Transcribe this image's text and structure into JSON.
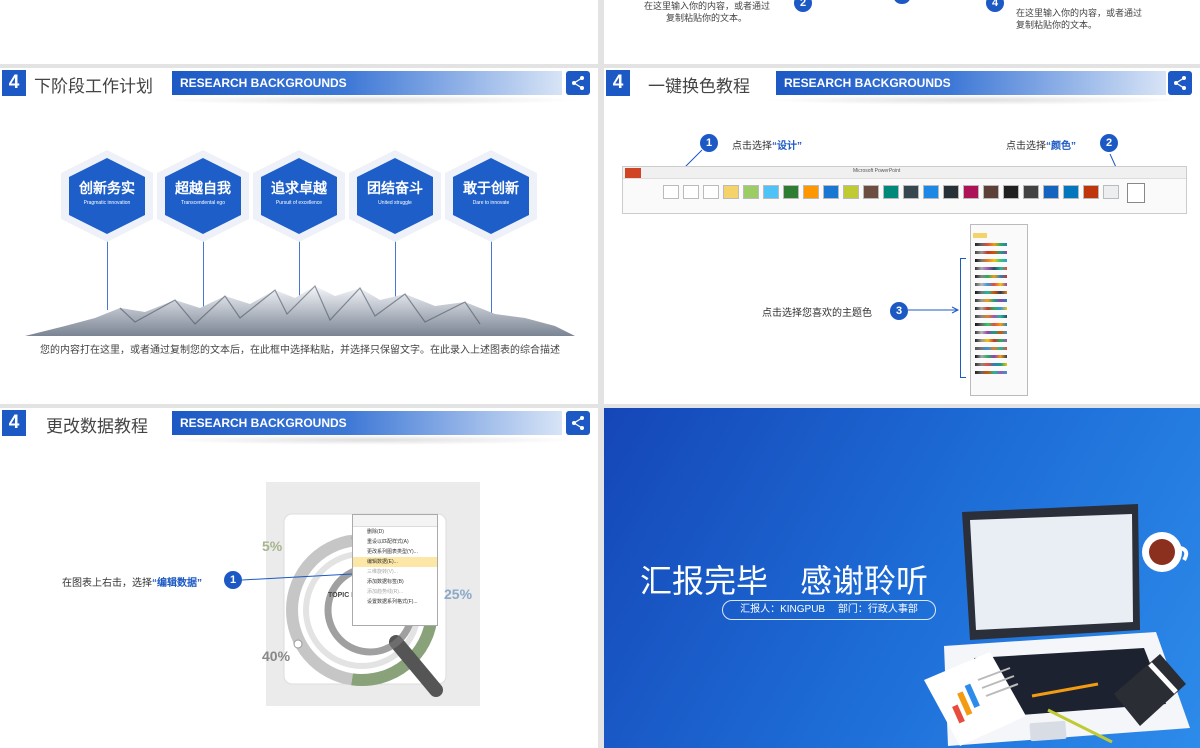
{
  "top_left": {
    "text_1": "在这里输入你的内容，或者通过",
    "text_2": "复制粘贴你的文本。",
    "step": "2"
  },
  "top_right": {
    "text_1": "在这里输入你的内容，或者通过",
    "text_2": "复制粘贴你的文本。",
    "step": "4"
  },
  "plan_slide": {
    "number": "4",
    "title": "下阶段工作计划",
    "banner": "RESEARCH BACKGROUNDS",
    "hexagons": [
      {
        "cn": "创新务实",
        "en": "Pragmatic innovation"
      },
      {
        "cn": "超越自我",
        "en": "Transcendental ego"
      },
      {
        "cn": "追求卓越",
        "en": "Pursuit of excellence"
      },
      {
        "cn": "团结奋斗",
        "en": "United struggle"
      },
      {
        "cn": "敢于创新",
        "en": "Dare to innovate"
      }
    ],
    "description": "您的内容打在这里，或者通过复制您的文本后，在此框中选择粘贴，并选择只保留文字。在此录入上述图表的综合描述"
  },
  "color_slide": {
    "number": "4",
    "title": "一键换色教程",
    "banner": "RESEARCH BACKGROUNDS",
    "step1": {
      "num": "1",
      "prefix": "点击选择",
      "highlight": "“设计”"
    },
    "step2": {
      "num": "2",
      "prefix": "点击选择",
      "highlight": "“颜色”"
    },
    "step3": {
      "num": "3",
      "label": "点击选择您喜欢的主题色"
    },
    "window_title": "Microsoft PowerPoint"
  },
  "data_slide": {
    "number": "4",
    "title": "更改数据教程",
    "banner": "RESEARCH BACKGROUNDS",
    "instruction_prefix": "在图表上右击，选择",
    "instruction_highlight": "“编辑数据”",
    "step": "1",
    "chart_labels": {
      "left_top": "5%",
      "right": "25%",
      "left_bottom": "40%",
      "topic": "TOPIC HI"
    },
    "menu_items": [
      "删除(D)",
      "重设以匹配样式(A)",
      "更改系列图表类型(Y)...",
      "编辑数据(E)...",
      "三维旋转(V)...",
      "添加数据标签(B)",
      "添加趋势线(R)...",
      "设置数据系列格式(F)..."
    ]
  },
  "end_slide": {
    "title": "汇报完毕　感谢聆听",
    "reporter": "汇报人：KINGPUB　 部门：行政人事部"
  },
  "colors": {
    "brand_blue": "#1c59c4",
    "end_bg": "#1e6fd8"
  }
}
